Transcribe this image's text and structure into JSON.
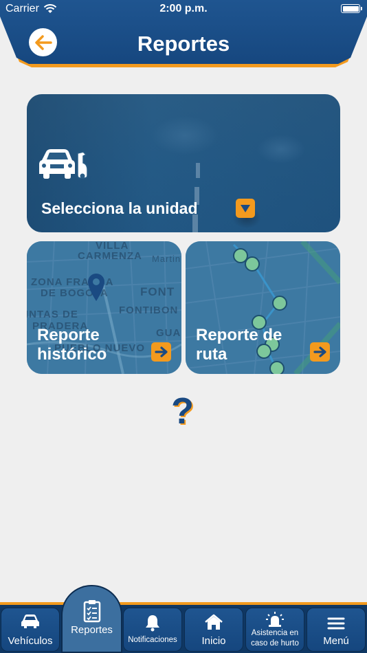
{
  "status_bar": {
    "carrier": "Carrier",
    "time": "2:00 p.m."
  },
  "header": {
    "title": "Reportes"
  },
  "cards": {
    "unit": {
      "label": "Selecciona la unidad"
    },
    "historic": {
      "line1": "Reporte",
      "line2": "histórico",
      "map_labels": [
        "VILLA",
        "CARMENZA",
        "Martin",
        "ZONA FRANCA",
        "DE BOGOTA",
        "FONT",
        "FONTIBON",
        "INTAS DE",
        "PRADERA",
        "PUEBLO NUEVO",
        "GUADU"
      ]
    },
    "route": {
      "line1": "Reporte de",
      "line2": "ruta"
    }
  },
  "help": {
    "symbol": "?"
  },
  "nav": {
    "items": [
      {
        "label": "Vehículos"
      },
      {
        "label": "Reportes"
      },
      {
        "label": "Notificaciones"
      },
      {
        "label": "Inicio"
      },
      {
        "label_line1": "Asistencia en",
        "label_line2": "caso de hurto"
      },
      {
        "label": "Menú"
      }
    ]
  },
  "colors": {
    "primary_blue": "#1f5590",
    "dark_blue": "#0f3763",
    "accent_orange": "#f39a1e",
    "background": "#efefef"
  }
}
